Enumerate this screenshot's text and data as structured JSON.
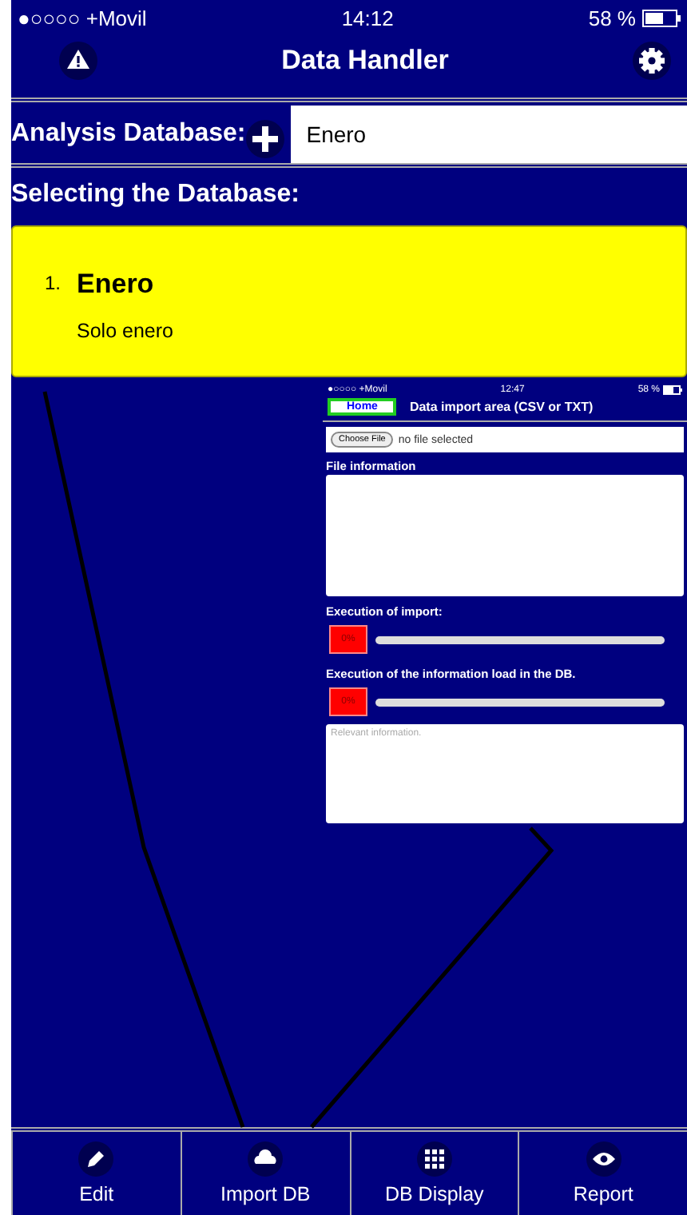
{
  "status_bar": {
    "carrier": "●○○○○ +Movil",
    "time": "14:12",
    "battery": "58 %"
  },
  "nav_bar": {
    "title": "Data Handler"
  },
  "analysis_database": {
    "label": "Analysis Database:",
    "value": "Enero"
  },
  "section_title": "Selecting the Database:",
  "databases": [
    {
      "number": "1.",
      "name": "Enero",
      "description": "Solo enero",
      "selected": true
    }
  ],
  "inset_screenshot": {
    "status_bar": {
      "carrier": "●○○○○ +Movil",
      "time": "12:47",
      "battery": "58 %"
    },
    "home_button": "Home",
    "title": "Data import area (CSV or TXT)",
    "file_button": "Choose File",
    "file_status": "no file selected",
    "file_info_label": "File information",
    "progress": [
      {
        "label": "Execution of import:",
        "reading": "0%",
        "level": 0
      },
      {
        "label": "Execution of the information load in the DB.",
        "reading": "0%",
        "level": 0
      }
    ],
    "notes_placeholder": "Relevant information."
  },
  "tab_bar": [
    {
      "kind": "edit",
      "label": "Edit"
    },
    {
      "kind": "cloud",
      "label": "Import DB"
    },
    {
      "kind": "grid",
      "label": "DB Display"
    },
    {
      "kind": "eye",
      "label": "Report"
    }
  ]
}
